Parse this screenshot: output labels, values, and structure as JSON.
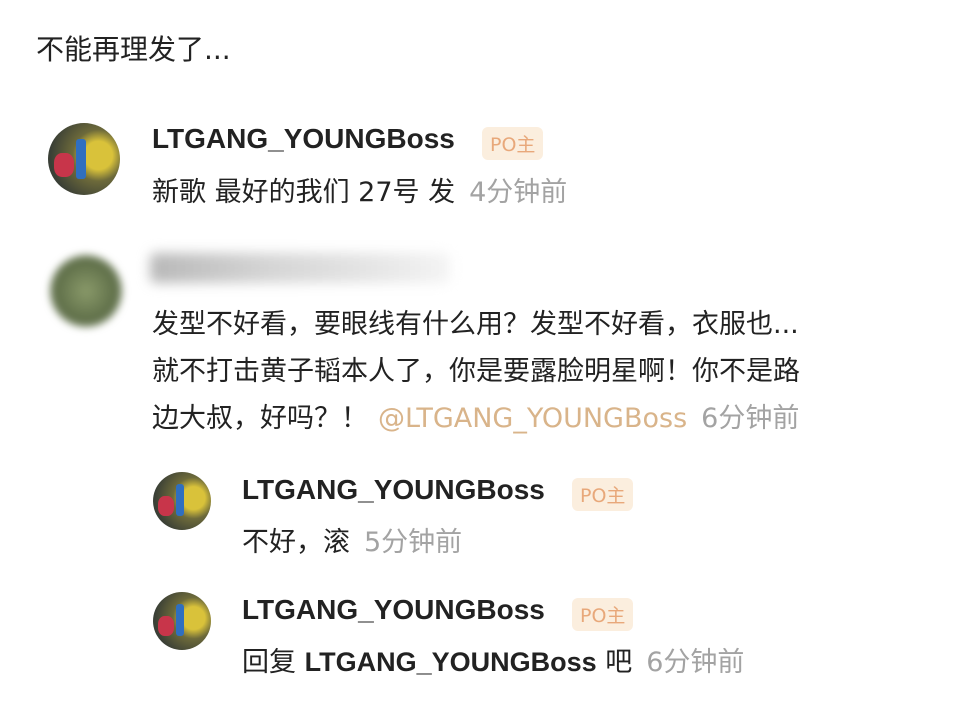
{
  "post": {
    "title": "不能再理发了..."
  },
  "comments": [
    {
      "username": "LTGANG_YOUNGBoss",
      "badge": "PO主",
      "text": "新歌 最好的我们 27号 发",
      "time": "4分钟前"
    },
    {
      "username_hidden": true,
      "line1": "发型不好看，要眼线有什么用？发型不好看，衣服也...",
      "line2": "就不打击黄子韬本人了，你是要露脸明星啊！你不是路",
      "line3_text": "边大叔，好吗？！",
      "mention": "@LTGANG_YOUNGBoss",
      "time": "6分钟前"
    }
  ],
  "replies": [
    {
      "username": "LTGANG_YOUNGBoss",
      "badge": "PO主",
      "text": "不好，滚",
      "time": "5分钟前"
    },
    {
      "username": "LTGANG_YOUNGBoss",
      "badge": "PO主",
      "prefix": "回复",
      "reply_to": "LTGANG_YOUNGBoss",
      "suffix": "吧",
      "time": "6分钟前"
    }
  ]
}
